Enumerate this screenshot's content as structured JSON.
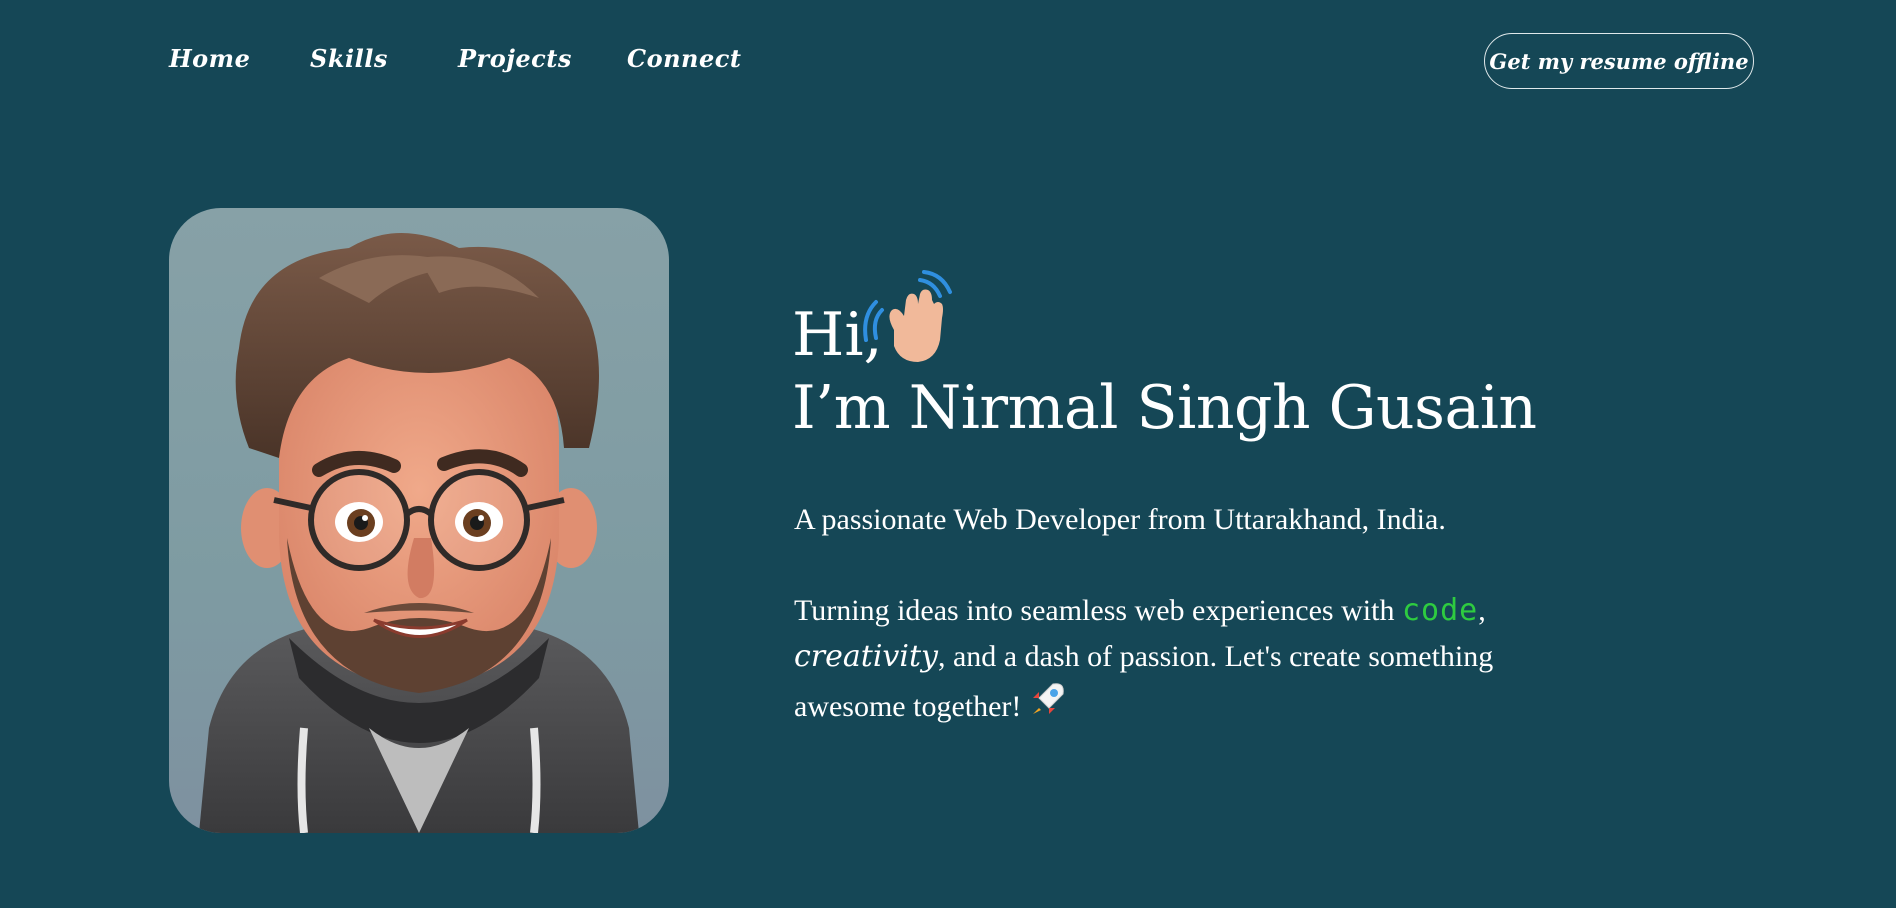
{
  "nav": {
    "links": [
      "Home",
      "Skills",
      "Projects",
      "Connect"
    ],
    "resume_label": "Get my resume offline"
  },
  "hero": {
    "greeting": "Hi,",
    "name": "I’m Nirmal Singh Gusain",
    "tagline": "A passionate Web Developer from Uttarakhand, India.",
    "para_start": "Turning ideas into seamless web experiences with ",
    "code_word": "code",
    "sep": ", ",
    "creativity_word": "creativity",
    "para_end": ", and a dash of passion. Let's create something awesome together!",
    "code_color": "#2ecc40"
  },
  "icons": {
    "wave": "waving-hand-icon",
    "rocket": "rocket-icon"
  },
  "colors": {
    "background": "#154756",
    "avatar_background": "#7f9aa1",
    "text": "#ffffff"
  }
}
